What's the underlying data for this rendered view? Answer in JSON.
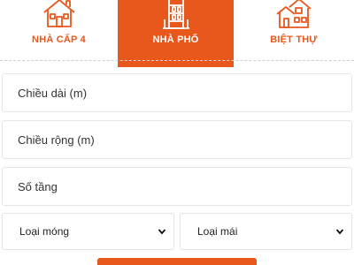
{
  "colors": {
    "accent": "#e8581d",
    "border": "#e6e6e6"
  },
  "tabs": [
    {
      "label": "NHÀ CẤP 4",
      "icon": "house-icon",
      "active": false
    },
    {
      "label": "NHÀ PHỐ",
      "icon": "townhouse-icon",
      "active": true
    },
    {
      "label": "BIỆT THỰ",
      "icon": "villa-icon",
      "active": false
    }
  ],
  "form": {
    "length_placeholder": "Chiều dài (m)",
    "width_placeholder": "Chiều rộng (m)",
    "floors_placeholder": "Số tầng",
    "foundation_select": {
      "selected": "Loại móng",
      "icon": "chevron-down-icon"
    },
    "roof_select": {
      "selected": "Loại mái",
      "icon": "chevron-down-icon"
    }
  }
}
